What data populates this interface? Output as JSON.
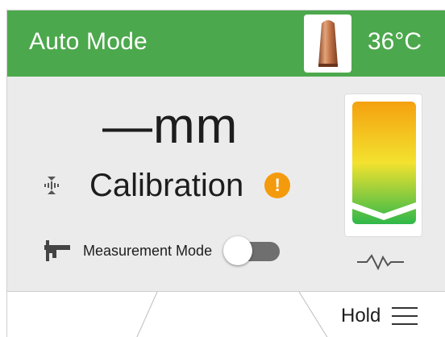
{
  "header": {
    "mode_title": "Auto Mode",
    "temperature": "36°C",
    "color": "#4ca84c",
    "tip_icon": "soldering-tip-icon"
  },
  "main": {
    "readout": "—mm",
    "calibration_label": "Calibration",
    "calibration_icon": "calibrate-icon",
    "warning_icon": "warning-icon",
    "warning_symbol": "!",
    "warning_color": "#f49a0d",
    "measurement_label": "Measurement Mode",
    "measurement_icon": "caliper-icon",
    "measurement_mode_on": false
  },
  "gauge": {
    "icon": "vertical-level-gauge",
    "gradient": [
      "#f4a10f",
      "#f3e22f",
      "#2fb84a"
    ],
    "waveform_icon": "waveform-icon"
  },
  "footer": {
    "hold_label": "Hold",
    "menu_icon": "hamburger-menu-icon"
  }
}
